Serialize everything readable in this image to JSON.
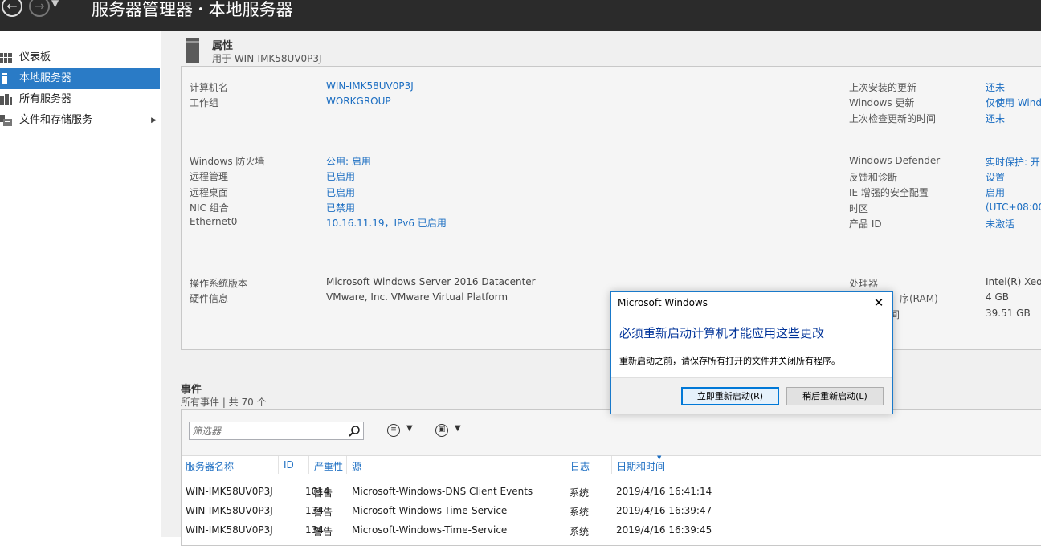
{
  "header": {
    "breadcrumb_root": "服务器管理器",
    "breadcrumb_sep": "•",
    "breadcrumb_current": "本地服务器"
  },
  "sidebar": {
    "items": [
      {
        "label": "仪表板",
        "icon": "dashboard-icon"
      },
      {
        "label": "本地服务器",
        "icon": "local-server-icon",
        "selected": true
      },
      {
        "label": "所有服务器",
        "icon": "all-servers-icon"
      },
      {
        "label": "文件和存储服务",
        "icon": "file-storage-icon",
        "has_children": true
      }
    ]
  },
  "properties": {
    "title": "属性",
    "subtitle": "用于 WIN-IMK58UV0P3J",
    "left": [
      {
        "label": "计算机名",
        "value": "WIN-IMK58UV0P3J"
      },
      {
        "label": "工作组",
        "value": "WORKGROUP"
      },
      {
        "label": "Windows 防火墙",
        "value": "公用: 启用"
      },
      {
        "label": "远程管理",
        "value": "已启用"
      },
      {
        "label": "远程桌面",
        "value": "已启用"
      },
      {
        "label": "NIC 组合",
        "value": "已禁用"
      },
      {
        "label": "Ethernet0",
        "value": "10.16.11.19，IPv6 已启用"
      },
      {
        "label": "操作系统版本",
        "value": "Microsoft Windows Server 2016 Datacenter"
      },
      {
        "label": "硬件信息",
        "value": "VMware, Inc. VMware Virtual Platform"
      }
    ],
    "right": [
      {
        "label": "上次安装的更新",
        "value": "还未"
      },
      {
        "label": "Windows 更新",
        "value": "仅使用 Wind"
      },
      {
        "label": "上次检查更新的时间",
        "value": "还未"
      },
      {
        "label": "Windows Defender",
        "value": "实时保护: 开"
      },
      {
        "label": "反馈和诊断",
        "value": "设置"
      },
      {
        "label": "IE 增强的安全配置",
        "value": "启用"
      },
      {
        "label": "时区",
        "value": "(UTC+08:00"
      },
      {
        "label": "产品 ID",
        "value": "未激活"
      },
      {
        "label": "处理器",
        "value": "Intel(R) Xeon"
      },
      {
        "label": "序(RAM)",
        "value": "4 GB"
      },
      {
        "label": "间",
        "value": "39.51 GB"
      }
    ]
  },
  "events": {
    "title": "事件",
    "subtitle": "所有事件 | 共 70 个",
    "filter_placeholder": "筛选器",
    "columns": [
      "服务器名称",
      "ID",
      "严重性",
      "源",
      "日志",
      "日期和时间"
    ],
    "rows": [
      [
        "WIN-IMK58UV0P3J",
        "1014",
        "警告",
        "Microsoft-Windows-DNS Client Events",
        "系统",
        "2019/4/16 16:41:14"
      ],
      [
        "WIN-IMK58UV0P3J",
        "134",
        "警告",
        "Microsoft-Windows-Time-Service",
        "系统",
        "2019/4/16 16:39:47"
      ],
      [
        "WIN-IMK58UV0P3J",
        "134",
        "警告",
        "Microsoft-Windows-Time-Service",
        "系统",
        "2019/4/16 16:39:45"
      ]
    ]
  },
  "dialog": {
    "title": "Microsoft Windows",
    "main_instruction": "必须重新启动计算机才能应用这些更改",
    "content": "重新启动之前，请保存所有打开的文件并关闭所有程序。",
    "button_primary": "立即重新启动(R)",
    "button_secondary": "稍后重新启动(L)"
  },
  "colors": {
    "titlebar": "#2b2b2b",
    "selection": "#2a7bc6",
    "link": "#1c6ec2",
    "dialog_instruction": "#003399"
  }
}
